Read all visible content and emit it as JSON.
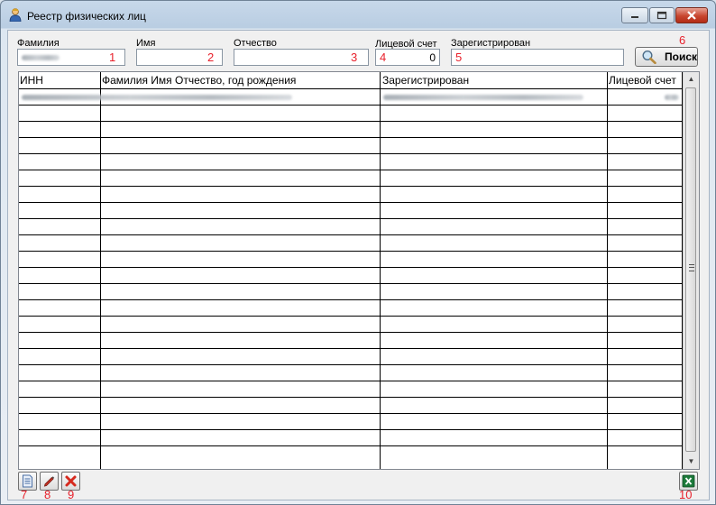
{
  "window": {
    "title": "Реестр физических лиц",
    "controls": {
      "minimize_icon": "minimize-icon",
      "maximize_icon": "maximize-icon",
      "close_icon": "close-icon"
    }
  },
  "filters": {
    "surname": {
      "label": "Фамилия",
      "value": "",
      "marker": "1"
    },
    "name": {
      "label": "Имя",
      "value": "",
      "marker": "2"
    },
    "patronymic": {
      "label": "Отчество",
      "value": "",
      "marker": "3"
    },
    "account": {
      "label": "Лицевой счет",
      "value": "0",
      "marker": "4"
    },
    "registered": {
      "label": "Зарегистрирован",
      "value": "",
      "marker": "5"
    }
  },
  "search_button": {
    "label": "Поиск",
    "icon": "magnifier-icon",
    "marker": "6"
  },
  "grid": {
    "columns": [
      "ИНН",
      "Фамилия Имя Отчество, год рождения",
      "Зарегистрирован",
      "Лицевой счет"
    ],
    "first_row_redacted": true,
    "empty_rows": 21
  },
  "toolbar": {
    "add": {
      "icon": "document-icon",
      "marker": "7"
    },
    "edit": {
      "icon": "pencil-icon",
      "marker": "8"
    },
    "delete": {
      "icon": "delete-x-icon",
      "marker": "9"
    },
    "export": {
      "icon": "excel-icon",
      "marker": "10"
    }
  },
  "colors": {
    "marker": "#e8202b",
    "accent": "#1c7a3a"
  }
}
